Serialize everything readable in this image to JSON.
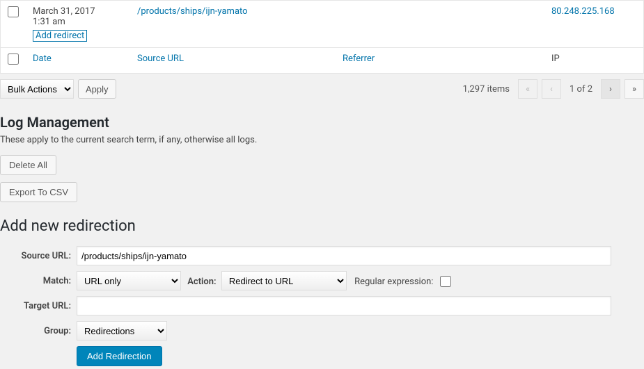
{
  "row": {
    "date": "March 31, 2017",
    "time": "1:31 am",
    "action": "Add redirect",
    "source": "/products/ships/ijn-yamato",
    "ip": "80.248.225.168"
  },
  "columns": {
    "date": "Date",
    "source": "Source URL",
    "referrer": "Referrer",
    "ip": "IP"
  },
  "bulk": {
    "label": "Bulk Actions",
    "apply": "Apply"
  },
  "pagination": {
    "items": "1,297 items",
    "pages": "1 of 2"
  },
  "log": {
    "heading": "Log Management",
    "desc": "These apply to the current search term, if any, otherwise all logs.",
    "delete": "Delete All",
    "export": "Export To CSV"
  },
  "addnew": {
    "heading": "Add new redirection",
    "source_label": "Source URL:",
    "source_value": "/products/ships/ijn-yamato",
    "match_label": "Match:",
    "match_value": "URL only",
    "action_label": "Action:",
    "action_value": "Redirect to URL",
    "regex_label": "Regular expression:",
    "target_label": "Target URL:",
    "target_value": "",
    "group_label": "Group:",
    "group_value": "Redirections",
    "submit": "Add Redirection"
  }
}
